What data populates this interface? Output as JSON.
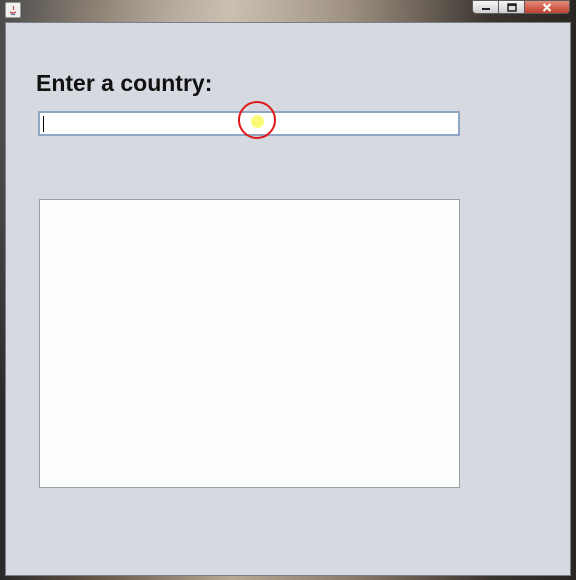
{
  "window": {
    "title": "",
    "app_icon": "java-icon",
    "controls": {
      "minimize_icon": "minimize-icon",
      "maximize_icon": "maximize-icon",
      "close_icon": "close-icon"
    }
  },
  "form": {
    "label": "Enter a country:",
    "input_value": "",
    "input_placeholder": ""
  },
  "results": {
    "items": []
  },
  "colors": {
    "window_background": "#d6d9e0",
    "input_border": "#8fa6c4",
    "cursor_ring": "#e01818",
    "cursor_dot": "#fbfb7a",
    "results_background": "#fcfefc"
  }
}
